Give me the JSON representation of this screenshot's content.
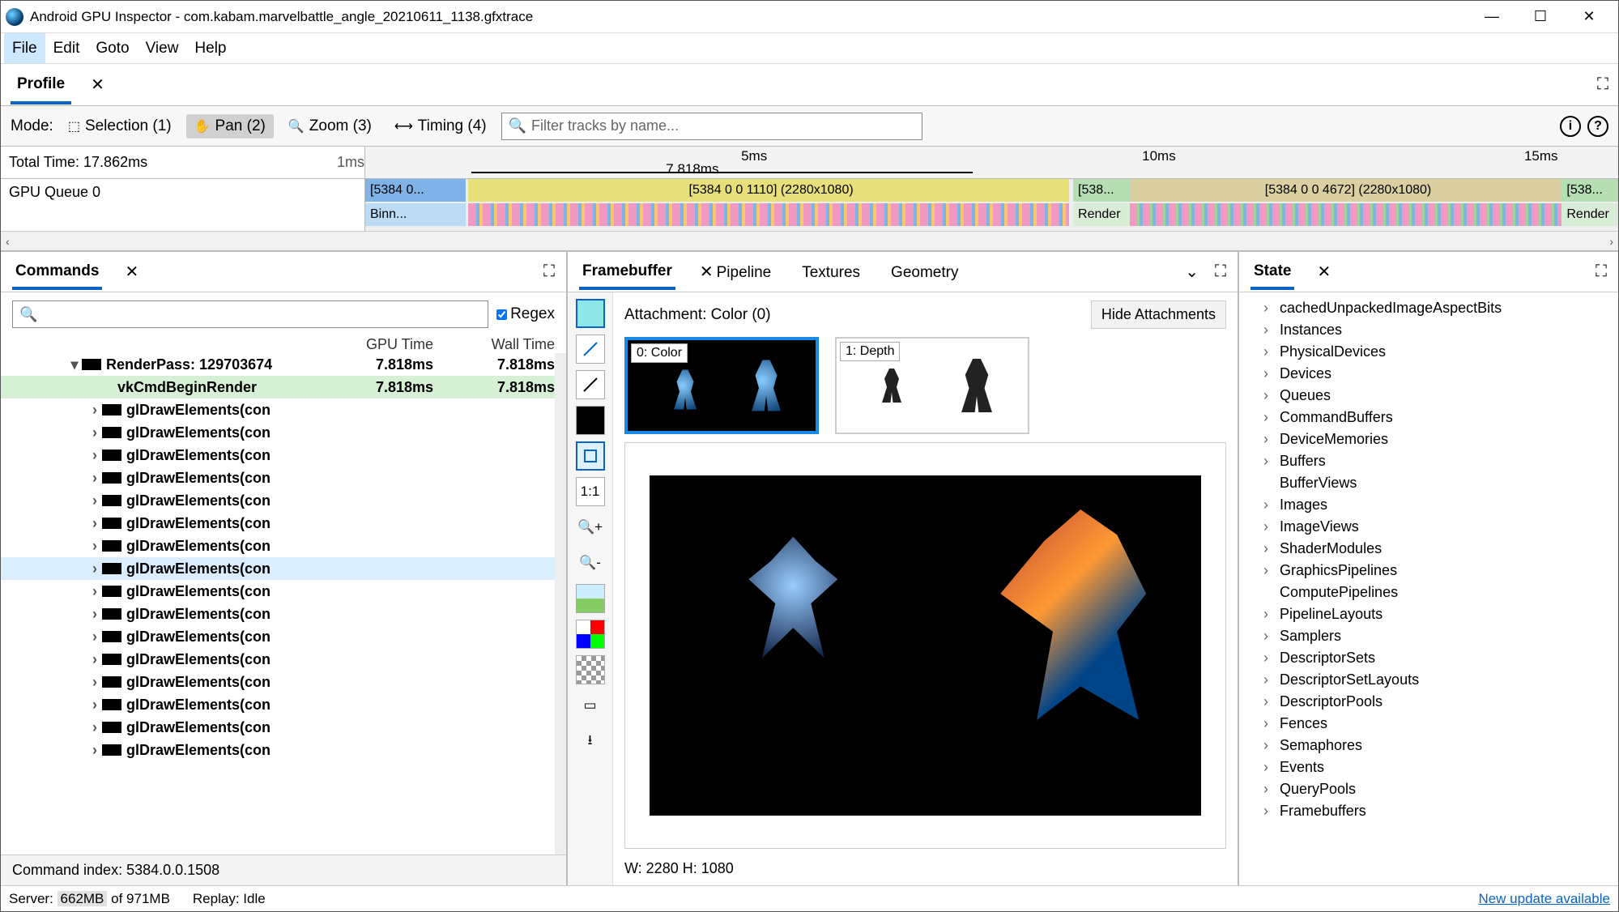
{
  "window": {
    "title": "Android GPU Inspector - com.kabam.marvelbattle_angle_20210611_1138.gfxtrace"
  },
  "menu": {
    "file": "File",
    "edit": "Edit",
    "goto": "Goto",
    "view": "View",
    "help": "Help"
  },
  "profile": {
    "tab": "Profile"
  },
  "toolbar": {
    "mode_label": "Mode:",
    "selection": "Selection (1)",
    "pan": "Pan (2)",
    "zoom": "Zoom (3)",
    "timing": "Timing (4)",
    "filter_placeholder": "Filter tracks by name..."
  },
  "timeline": {
    "total_time": "Total Time: 17.862ms",
    "scale_unit": "1ms",
    "ticks": {
      "t5": "5ms",
      "t10": "10ms",
      "t15": "15ms"
    },
    "range_label": "7.818ms",
    "queue_label": "GPU Queue 0",
    "segments": {
      "a": "[5384 0...",
      "a_lower": "Binn...",
      "b": "[5384 0 0 1110] (2280x1080)",
      "c": "[538...",
      "c_lower": "Render",
      "d": "[5384 0 0 4672] (2280x1080)",
      "e": "[538...",
      "e_lower": "Render"
    }
  },
  "commands": {
    "tab": "Commands",
    "regex": "Regex",
    "headers": {
      "gpu": "GPU Time",
      "wall": "Wall Time"
    },
    "rows": {
      "rp": {
        "label": "RenderPass: 129703674",
        "gpu": "7.818ms",
        "wall": "7.818ms"
      },
      "begin": {
        "label": "vkCmdBeginRender",
        "gpu": "7.818ms",
        "wall": "7.818ms"
      },
      "draw": "glDrawElements(con"
    },
    "footer": "Command index: 5384.0.0.1508"
  },
  "center": {
    "tabs": {
      "fb": "Framebuffer",
      "pipeline": "Pipeline",
      "textures": "Textures",
      "geometry": "Geometry"
    },
    "attachment": "Attachment: Color (0)",
    "hide": "Hide Attachments",
    "thumb0": "0: Color",
    "thumb1": "1: Depth",
    "dims": "W: 2280 H: 1080",
    "onebyone": "1:1"
  },
  "state": {
    "tab": "State",
    "items": [
      "cachedUnpackedImageAspectBits",
      "Instances",
      "PhysicalDevices",
      "Devices",
      "Queues",
      "CommandBuffers",
      "DeviceMemories",
      "Buffers",
      "BufferViews",
      "Images",
      "ImageViews",
      "ShaderModules",
      "GraphicsPipelines",
      "ComputePipelines",
      "PipelineLayouts",
      "Samplers",
      "DescriptorSets",
      "DescriptorSetLayouts",
      "DescriptorPools",
      "Fences",
      "Semaphores",
      "Events",
      "QueryPools",
      "Framebuffers"
    ]
  },
  "status": {
    "server_prefix": "Server:",
    "server_mem": "662MB",
    "server_of": "of 971MB",
    "replay": "Replay: Idle",
    "update": "New update available"
  }
}
